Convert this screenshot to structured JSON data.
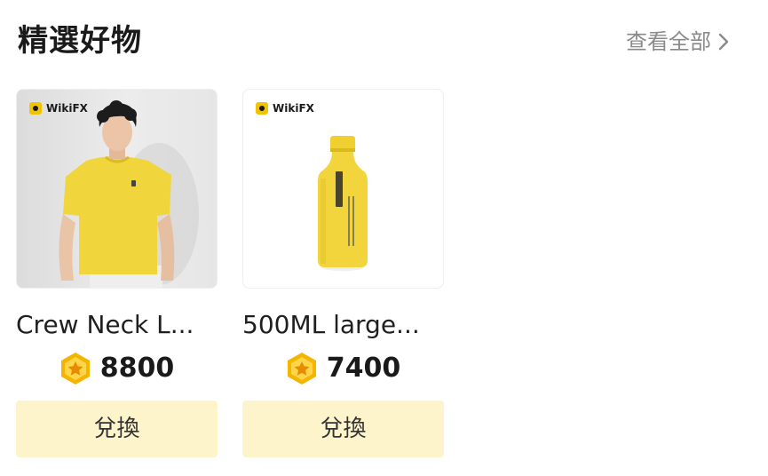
{
  "section": {
    "title": "精選好物",
    "view_all_label": "查看全部"
  },
  "products": [
    {
      "brand": "WikiFX",
      "name": "Crew Neck L...",
      "price": "8800",
      "redeem_label": "兌換"
    },
    {
      "brand": "WikiFX",
      "name": "500ML large...",
      "price": "7400",
      "redeem_label": "兌換"
    }
  ],
  "icons": {
    "view_all": "chevron-right-icon",
    "coin": "star-coin-icon"
  },
  "colors": {
    "accent_yellow": "#f2d53c",
    "button_bg": "#fdf4cc",
    "muted_text": "#8a8a8a"
  }
}
